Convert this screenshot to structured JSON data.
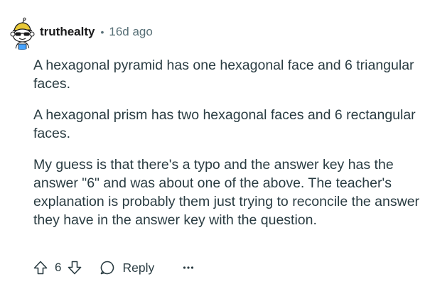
{
  "comment": {
    "author": "truthealty",
    "separator": "•",
    "age": "16d ago",
    "avatar_icon": "snoo-sunglasses-avatar-icon",
    "paragraphs": [
      "A hexagonal pyramid has one hexagonal face and 6 triangular faces.",
      "A hexagonal prism has two hexagonal faces and 6 rectangular faces.",
      "My guess is that there's a typo and the answer key has the answer \"6\" and was about one of the above. The teacher's explanation is probably them just trying to reconcile the answer they have in the answer key with the question."
    ],
    "actions": {
      "upvote_icon": "upvote-arrow-icon",
      "score": "6",
      "downvote_icon": "downvote-arrow-icon",
      "reply_icon": "speech-bubble-icon",
      "reply_label": "Reply",
      "more_icon": "more-options-icon"
    }
  },
  "colors": {
    "text_primary": "#1a1a1b",
    "text_body": "#2a3c42",
    "text_meta": "#576f76",
    "background": "#ffffff"
  }
}
